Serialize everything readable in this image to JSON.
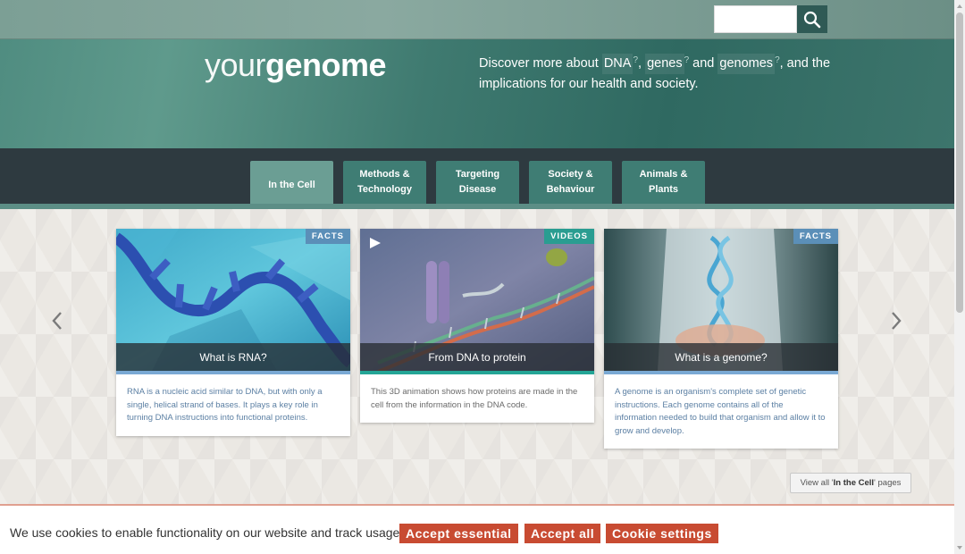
{
  "header": {
    "logo_light": "your",
    "logo_bold": "genome",
    "tagline_prefix": "Discover more about ",
    "term_dna": "DNA",
    "term_genes": "genes",
    "term_genomes": "genomes",
    "tagline_suffix": "implications for our health and society.",
    "tagline_and_the": ", and the",
    "sep_comma": ",",
    "sep_and": "and",
    "glossary_mark": "?",
    "search_value": ""
  },
  "nav": {
    "tabs": [
      {
        "label": "In the Cell",
        "active": true
      },
      {
        "label": "Methods & Technology",
        "line1": "Methods &",
        "line2": "Technology"
      },
      {
        "label": "Targeting Disease",
        "line1": "Targeting",
        "line2": "Disease"
      },
      {
        "label": "Society & Behaviour",
        "line1": "Society &",
        "line2": "Behaviour"
      },
      {
        "label": "Animals & Plants",
        "line1": "Animals &",
        "line2": "Plants"
      }
    ]
  },
  "cards": [
    {
      "badge": "FACTS",
      "title": "What is RNA?",
      "desc": "RNA is a nucleic acid similar to DNA, but with only a single, helical strand of bases. It plays a key role in turning DNA instructions into functional proteins."
    },
    {
      "badge": "VIDEOS",
      "title": "From DNA to protein",
      "desc": "This 3D animation shows how proteins are made in the cell from the information in the DNA code."
    },
    {
      "badge": "FACTS",
      "title": "What is a genome?",
      "desc": "A genome is an organism's complete set of genetic instructions. Each genome contains all of the information needed to build that organism and allow it to grow and develop."
    }
  ],
  "view_all": {
    "prefix": "View all '",
    "bold": "In the Cell",
    "suffix": "' pages"
  },
  "cookie": {
    "message": "We use cookies to enable functionality on our website and track usage.",
    "accept_essential": "Accept essential",
    "accept_all": "Accept all",
    "settings": "Cookie settings"
  },
  "colors": {
    "header_teal": "#3f7a70",
    "nav_dark": "#2e3a40",
    "tab_teal": "#3f7d74",
    "facts_badge": "#5b8fb8",
    "videos_badge": "#2a9d91",
    "cookie_button": "#c84b32"
  },
  "icons": [
    "search-icon",
    "chevron-left-icon",
    "chevron-right-icon",
    "play-icon"
  ]
}
